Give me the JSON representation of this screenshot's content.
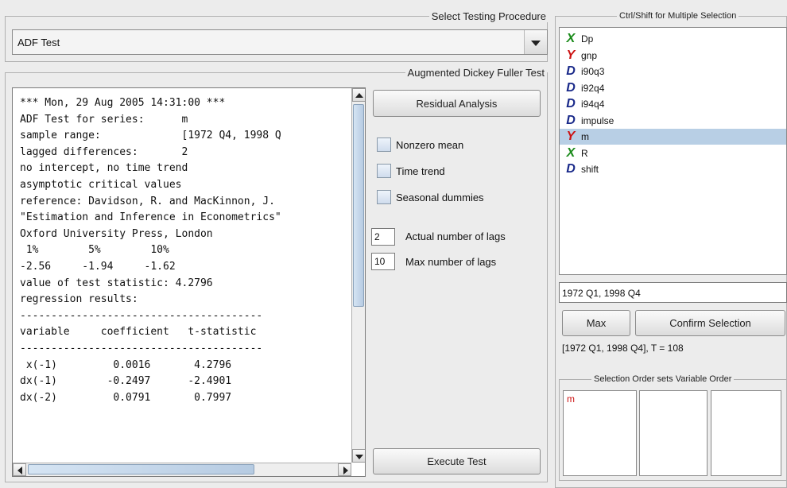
{
  "procedure": {
    "legend": "Select Testing Procedure",
    "selected": "ADF Test"
  },
  "adf": {
    "legend": "Augmented Dickey Fuller Test",
    "output_lines": [
      "*** Mon, 29 Aug 2005 14:31:00 ***",
      "ADF Test for series:      m",
      "sample range:             [1972 Q4, 1998 Q",
      "lagged differences:       2",
      "no intercept, no time trend",
      "asymptotic critical values",
      "reference: Davidson, R. and MacKinnon, J.",
      "\"Estimation and Inference in Econometrics\"",
      "Oxford University Press, London",
      " 1%        5%        10%",
      "-2.56     -1.94     -1.62",
      "value of test statistic: 4.2796",
      "regression results:",
      "---------------------------------------",
      "variable     coefficient   t-statistic",
      "---------------------------------------",
      " x(-1)         0.0016       4.2796",
      "dx(-1)        -0.2497      -2.4901",
      "dx(-2)         0.0791       0.7997"
    ],
    "residual_button": "Residual Analysis",
    "nonzero_mean": "Nonzero mean",
    "time_trend": "Time trend",
    "seasonal_dummies": "Seasonal dummies",
    "actual_lags_value": "2",
    "actual_lags_label": "Actual number of lags",
    "max_lags_value": "10",
    "max_lags_label": "Max number of lags",
    "execute_button": "Execute Test"
  },
  "variables": {
    "legend": "Ctrl/Shift for Multiple Selection",
    "items": [
      {
        "type": "X",
        "name": "Dp",
        "selected": false
      },
      {
        "type": "Y",
        "name": "gnp",
        "selected": false
      },
      {
        "type": "D",
        "name": "i90q3",
        "selected": false
      },
      {
        "type": "D",
        "name": "i92q4",
        "selected": false
      },
      {
        "type": "D",
        "name": "i94q4",
        "selected": false
      },
      {
        "type": "D",
        "name": "impulse",
        "selected": false
      },
      {
        "type": "Y",
        "name": "m",
        "selected": true
      },
      {
        "type": "X",
        "name": "R",
        "selected": false
      },
      {
        "type": "D",
        "name": "shift",
        "selected": false
      }
    ],
    "type_colors": {
      "X": "#1a8a1a",
      "Y": "#cc1111",
      "D": "#1a2a8a"
    },
    "range_value": "1972 Q1, 1998 Q4",
    "max_button": "Max",
    "confirm_button": "Confirm Selection",
    "range_info": "[1972 Q1, 1998 Q4], T = 108",
    "order_legend": "Selection Order sets Variable Order",
    "order_lists": [
      [
        "m"
      ],
      [],
      []
    ]
  }
}
